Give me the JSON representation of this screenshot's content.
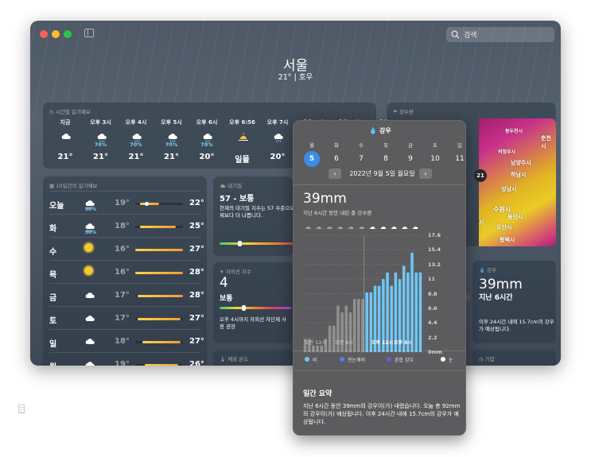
{
  "window": {
    "title": "서울"
  },
  "search": {
    "placeholder": "검색"
  },
  "current": {
    "city": "서울",
    "summary": "21°  |  호우"
  },
  "hourly": {
    "title": "시간별 일기예보",
    "items": [
      {
        "time": "지금",
        "icon": "cloud-icon",
        "precip": "",
        "temp": "21°"
      },
      {
        "time": "오후 3시",
        "icon": "cloud-rain-icon",
        "precip": "70%",
        "temp": "21°"
      },
      {
        "time": "오후 4시",
        "icon": "cloud-rain-icon",
        "precip": "70%",
        "temp": "21°"
      },
      {
        "time": "오후 5시",
        "icon": "cloud-rain-icon",
        "precip": "70%",
        "temp": "21°"
      },
      {
        "time": "오후 6시",
        "icon": "cloud-rain-icon",
        "precip": "70%",
        "temp": "20°"
      },
      {
        "time": "오후 6:56",
        "icon": "sunset-icon",
        "precip": "",
        "temp": "일몰"
      },
      {
        "time": "오후 7시",
        "icon": "cloud-rain-icon",
        "precip": "",
        "temp": "20°"
      },
      {
        "time": "오후 8시",
        "icon": "cloud-rain-icon",
        "precip": "",
        "temp": ""
      },
      {
        "time": "오후 9시",
        "icon": "cloud-rain-icon",
        "precip": "",
        "temp": ""
      },
      {
        "time": "오후",
        "icon": "cloud-rain-icon",
        "precip": "",
        "temp": ""
      }
    ]
  },
  "daily": {
    "title": "10일간의 일기예보",
    "items": [
      {
        "day": "오늘",
        "icon": "cloud-rain-icon",
        "precip": "90%",
        "low": "19°",
        "high": "22°",
        "bar_start": 0.1,
        "bar_end": 0.5,
        "current_marker": 0.2
      },
      {
        "day": "화",
        "icon": "cloud-rain-icon",
        "precip": "50%",
        "low": "18°",
        "high": "25°",
        "bar_start": 0.1,
        "bar_end": 0.85
      },
      {
        "day": "수",
        "icon": "sun-icon",
        "precip": "",
        "low": "16°",
        "high": "27°",
        "bar_start": 0.0,
        "bar_end": 1.0
      },
      {
        "day": "목",
        "icon": "sun-icon",
        "precip": "",
        "low": "16°",
        "high": "28°",
        "bar_start": 0.0,
        "bar_end": 1.0
      },
      {
        "day": "금",
        "icon": "cloud-icon",
        "precip": "",
        "low": "17°",
        "high": "28°",
        "bar_start": 0.05,
        "bar_end": 1.0
      },
      {
        "day": "토",
        "icon": "cloud-icon",
        "precip": "",
        "low": "17°",
        "high": "27°",
        "bar_start": 0.05,
        "bar_end": 0.95
      },
      {
        "day": "일",
        "icon": "cloud-icon",
        "precip": "",
        "low": "18°",
        "high": "27°",
        "bar_start": 0.15,
        "bar_end": 0.95
      },
      {
        "day": "월",
        "icon": "cloud-icon",
        "precip": "",
        "low": "19°",
        "high": "26°",
        "bar_start": 0.2,
        "bar_end": 0.9
      }
    ]
  },
  "air": {
    "title": "대기질",
    "value": "57 - 보통",
    "desc": "현재의 대기질 지수는 57 수준으로 어제보다 더 나쁩니다."
  },
  "uv": {
    "title": "자외선 지수",
    "value": "4",
    "level": "보통",
    "desc": "오후 4시까지 자외선 차단제 사용 권장"
  },
  "feels": {
    "title": "체감 온도"
  },
  "precip_map": {
    "title": "강수량",
    "labels": [
      "동두천시",
      "의정부시",
      "남양주시",
      "하남시",
      "성남시",
      "수원시",
      "용인시",
      "오산시",
      "평택시",
      "춘천시",
      "시"
    ],
    "location_temp": "21"
  },
  "rain_card": {
    "title": "강우",
    "amount": "39mm",
    "period": "지난 6시간",
    "desc": "이후 24시간 내에 15.7cm의 강우가 예상됩니다."
  },
  "pressure_card": {
    "title": "기압"
  },
  "popup": {
    "title": "강우",
    "weekdays": [
      "월",
      "화",
      "수",
      "목",
      "금",
      "토",
      "일"
    ],
    "dates": [
      "5",
      "6",
      "7",
      "8",
      "9",
      "10",
      "11"
    ],
    "selected_date": "2022년 9월 5일 월요일",
    "amount": "39mm",
    "amount_sub": "지난 6시간 동안 내린 총 강수량",
    "summary_title": "일간 요약",
    "summary_text": "지난 6시간 동안 39mm의 강우이(가) 내렸습니다. 오늘 총 92mm의 강우이(가) 예상됩니다. 이후 24시간 내에 15.7cm의 강우가 예상됩니다.",
    "legend": [
      {
        "label": "비",
        "color": "#6ec6f5"
      },
      {
        "label": "진눈깨비",
        "color": "#4f7fe8"
      },
      {
        "label": "혼합 강우",
        "color": "#6c59d8"
      },
      {
        "label": "눈",
        "color": "#ffffff"
      }
    ]
  },
  "chart_data": {
    "type": "bar",
    "ylabel": "mm",
    "yticks": [
      "17.6",
      "15.4",
      "13.2",
      "11",
      "8.8",
      "6.6",
      "4.4",
      "2.2",
      "0mm"
    ],
    "ylim": [
      0,
      17.6
    ],
    "xticks": [
      "오전 12시",
      "오전 6시",
      "오후 12시",
      "오후 6시"
    ],
    "past_values": [
      2,
      2,
      1,
      1,
      1,
      2,
      4,
      4,
      7,
      6,
      7,
      6,
      8,
      8,
      8
    ],
    "future_values": [
      9,
      9,
      10,
      10,
      11,
      12,
      10,
      12,
      11,
      13,
      12,
      15,
      12,
      12
    ]
  }
}
